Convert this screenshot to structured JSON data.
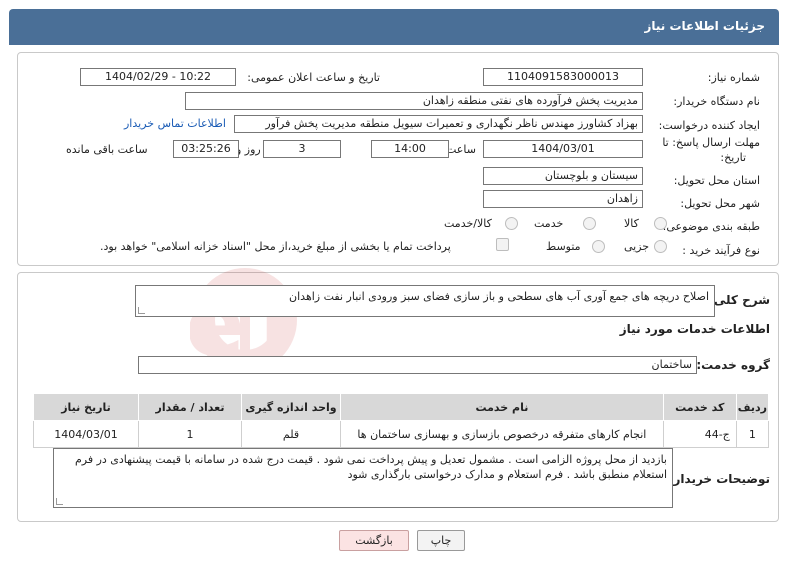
{
  "header": {
    "title": "جزئیات اطلاعات نیاز"
  },
  "fields": {
    "need_number_label": "شماره نیاز:",
    "need_number": "1104091583000013",
    "announce_label": "تاریخ و ساعت اعلان عمومی:",
    "announce_value": "1404/02/29 - 10:22",
    "buyer_org_label": "نام دستگاه خریدار:",
    "buyer_org": "مدیریت پخش فرآورده های نفتی منطقه زاهدان",
    "creator_label": "ایجاد کننده درخواست:",
    "creator": "بهزاد کشاورز مهندس ناظر نگهداری و تعمیرات سیویل منطقه  مدیریت پخش فرآور",
    "contact_link": "اطلاعات تماس خریدار",
    "deadline_label_1": "مهلت ارسال پاسخ: تا",
    "deadline_label_2": "تاریخ:",
    "deadline_date": "1404/03/01",
    "time_label": "ساعت",
    "deadline_time": "14:00",
    "days_value": "3",
    "days_label": "روز و",
    "remaining_time": "03:25:26",
    "remaining_label": "ساعت باقی مانده",
    "province_label": "استان محل تحویل:",
    "province": "سیستان و بلوچستان",
    "city_label": "شهر محل تحویل:",
    "city": "زاهدان",
    "category_label": "طبقه بندی موضوعی:",
    "category_options": [
      "کالا",
      "خدمت",
      "کالا/خدمت"
    ],
    "process_label": "نوع فرآیند خرید :",
    "process_options": [
      "جزیی",
      "متوسط"
    ],
    "payment_note": "پرداخت تمام یا بخشی از مبلغ خرید،از محل \"اسناد خزانه اسلامی\" خواهد بود."
  },
  "summary": {
    "label": "شرح کلی نیاز:",
    "text": "اصلاح دریچه های جمع آوری آب های سطحی و باز سازی فضای سبز ورودی انبار نفت زاهدان"
  },
  "services": {
    "section_title": "اطلاعات خدمات مورد نیاز",
    "group_label": "گروه خدمت:",
    "group_value": "ساختمان",
    "columns": [
      "ردیف",
      "کد خدمت",
      "نام خدمت",
      "واحد اندازه گیری",
      "تعداد / مقدار",
      "تاریخ نیاز"
    ],
    "rows": [
      [
        "1",
        "ج-44",
        "انجام کارهای متفرقه درخصوص بازسازی و بهسازی ساختمان ها",
        "قلم",
        "1",
        "1404/03/01"
      ]
    ]
  },
  "buyer_notes": {
    "label": "توضیحات خریدار:",
    "text": "بازدید از محل پروژه الزامی است . مشمول تعدیل و پیش پرداخت نمی شود . قیمت درج شده در سامانه با قیمت پیشنهادی در فرم استعلام منطبق باشد . فرم استعلام و مدارک درخواستی بارگذاری شود"
  },
  "buttons": {
    "print": "چاپ",
    "back": "بازگشت"
  },
  "watermark": {
    "text": "AriaTender.neT"
  },
  "colors": {
    "header_bg": "#4a6f97",
    "link": "#1a5bb5",
    "back_btn_bg": "#fbe3e3"
  }
}
